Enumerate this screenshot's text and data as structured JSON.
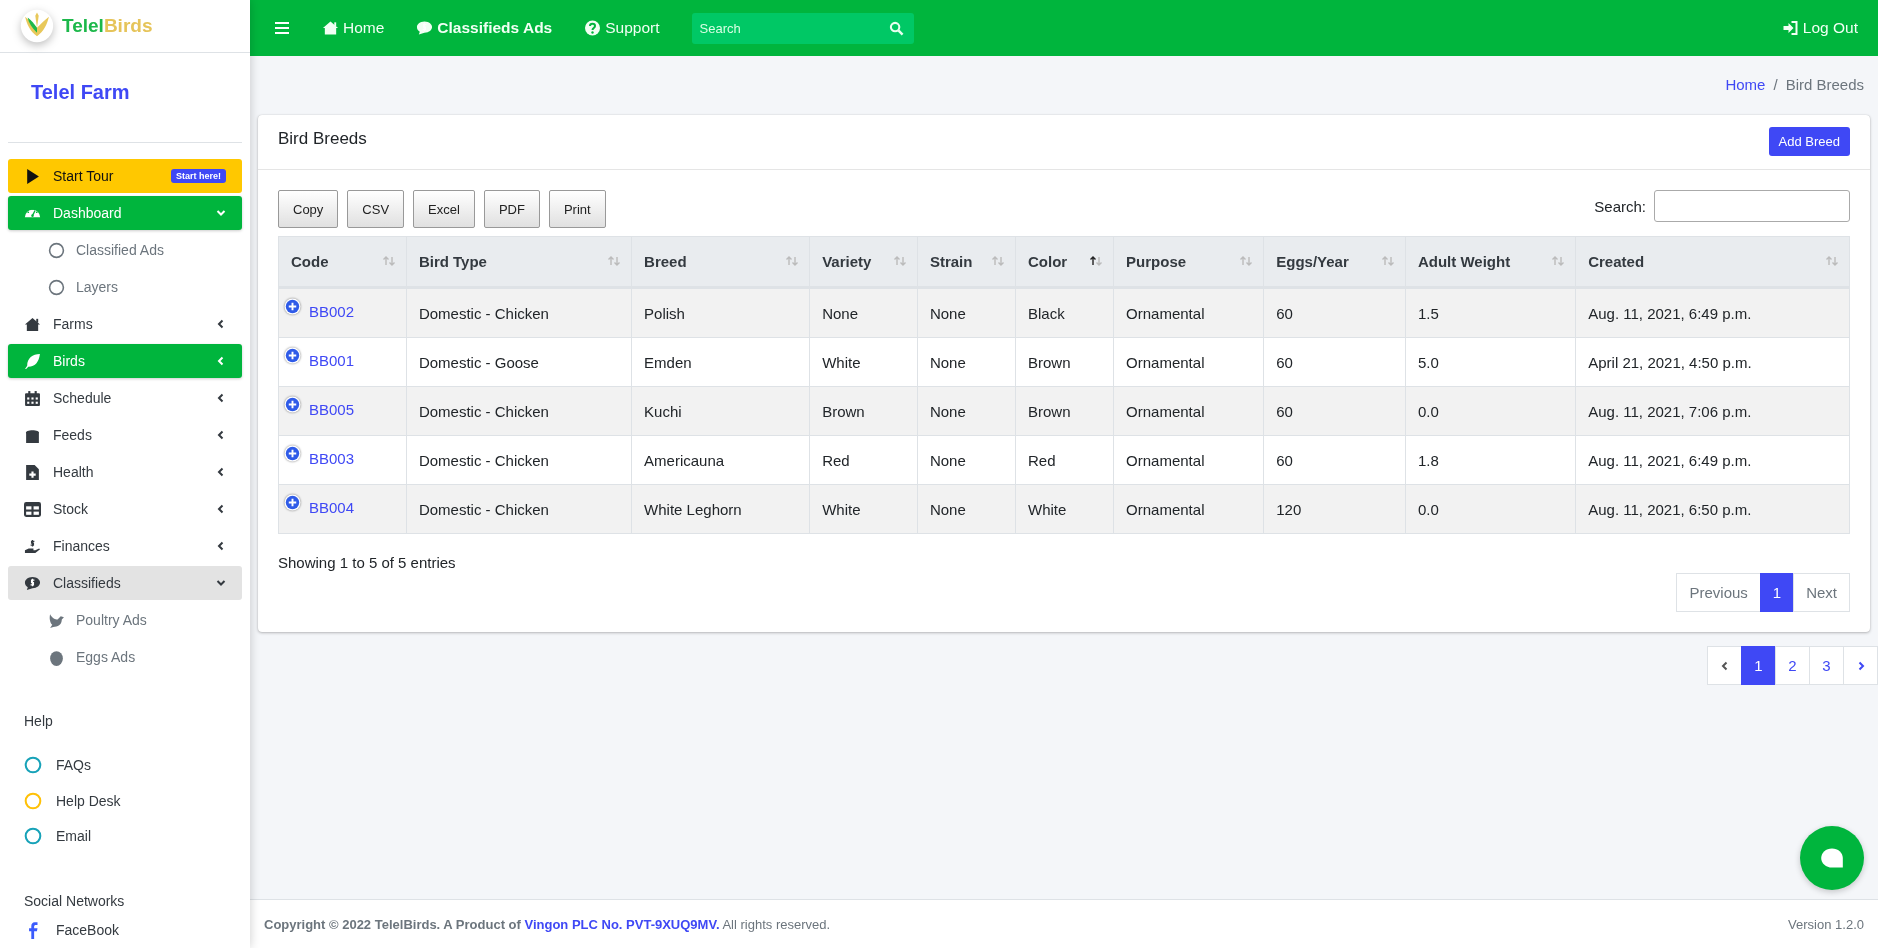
{
  "brand": {
    "part_1": "Telel",
    "part_2": "Birds"
  },
  "farm_name": "Telel Farm",
  "sidebar": {
    "items": [
      {
        "kind": "tour",
        "label": "Start Tour",
        "badge": "Start here!"
      },
      {
        "kind": "menu",
        "label": "Dashboard",
        "selected": true,
        "expanded": true,
        "children": [
          {
            "label": "Classified Ads"
          },
          {
            "label": "Layers"
          }
        ]
      },
      {
        "kind": "menu",
        "label": "Farms",
        "selected": false,
        "expanded": false
      },
      {
        "kind": "menu",
        "label": "Birds",
        "selected": true,
        "expanded": false
      },
      {
        "kind": "menu",
        "label": "Schedule",
        "selected": false,
        "expanded": false
      },
      {
        "kind": "menu",
        "label": "Feeds",
        "selected": false,
        "expanded": false
      },
      {
        "kind": "menu",
        "label": "Health",
        "selected": false,
        "expanded": false
      },
      {
        "kind": "menu",
        "label": "Stock",
        "selected": false,
        "expanded": false
      },
      {
        "kind": "menu",
        "label": "Finances",
        "selected": false,
        "expanded": false
      },
      {
        "kind": "menu",
        "label": "Classifieds",
        "selected": false,
        "expanded": true,
        "children": [
          {
            "label": "Poultry Ads"
          },
          {
            "label": "Eggs Ads"
          }
        ]
      }
    ],
    "help": {
      "title": "Help",
      "links": [
        {
          "label": "FAQs",
          "color": "#17a2b8"
        },
        {
          "label": "Help Desk",
          "color": "#ffc107"
        },
        {
          "label": "Email",
          "color": "#17a2b8"
        }
      ]
    },
    "social": {
      "title": "Social Networks",
      "links": [
        {
          "label": "FaceBook"
        }
      ]
    }
  },
  "topbar": {
    "links": [
      {
        "label": "Home",
        "bold": false
      },
      {
        "label": "Classifieds Ads",
        "bold": true
      },
      {
        "label": "Support",
        "bold": false
      }
    ],
    "search": {
      "placeholder": "Search"
    },
    "logout": "Log Out"
  },
  "breadcrumb": {
    "separator": "/",
    "items": [
      {
        "label": "Home",
        "link": true
      },
      {
        "label": "Bird Breeds",
        "link": false
      }
    ]
  },
  "card": {
    "title": "Bird Breeds",
    "add_button": "Add Breed",
    "export_buttons": [
      "Copy",
      "CSV",
      "Excel",
      "PDF",
      "Print"
    ],
    "search_label": "Search:",
    "table": {
      "columns": [
        {
          "label": "Code",
          "sorted": false
        },
        {
          "label": "Bird Type",
          "sorted": false
        },
        {
          "label": "Breed",
          "sorted": false
        },
        {
          "label": "Variety",
          "sorted": false
        },
        {
          "label": "Strain",
          "sorted": false
        },
        {
          "label": "Color",
          "sorted": true
        },
        {
          "label": "Purpose",
          "sorted": false
        },
        {
          "label": "Eggs/Year",
          "sorted": false
        },
        {
          "label": "Adult Weight",
          "sorted": false
        },
        {
          "label": "Created",
          "sorted": false
        }
      ],
      "rows": [
        [
          "BB002",
          "Domestic - Chicken",
          "Polish",
          "None",
          "None",
          "Black",
          "Ornamental",
          "60",
          "1.5",
          "Aug. 11, 2021, 6:49 p.m."
        ],
        [
          "BB001",
          "Domestic - Goose",
          "Emden",
          "White",
          "None",
          "Brown",
          "Ornamental",
          "60",
          "5.0",
          "April 21, 2021, 4:50 p.m."
        ],
        [
          "BB005",
          "Domestic - Chicken",
          "Kuchi",
          "Brown",
          "None",
          "Brown",
          "Ornamental",
          "60",
          "0.0",
          "Aug. 11, 2021, 7:06 p.m."
        ],
        [
          "BB003",
          "Domestic - Chicken",
          "Americauna",
          "Red",
          "None",
          "Red",
          "Ornamental",
          "60",
          "1.8",
          "Aug. 11, 2021, 6:49 p.m."
        ],
        [
          "BB004",
          "Domestic - Chicken",
          "White Leghorn",
          "White",
          "None",
          "White",
          "Ornamental",
          "120",
          "0.0",
          "Aug. 11, 2021, 6:50 p.m."
        ]
      ]
    },
    "info": "Showing 1 to 5 of 5 entries",
    "pager": {
      "previous": "Previous",
      "next": "Next",
      "pages": [
        {
          "label": "1",
          "selected": true
        }
      ]
    }
  },
  "page_pager": {
    "pages": [
      {
        "label": "1",
        "selected": true
      },
      {
        "label": "2",
        "selected": false
      },
      {
        "label": "3",
        "selected": false
      }
    ]
  },
  "footer": {
    "text_1": "Copyright © 2022 TelelBirds. A Product of",
    "link": "Vingon PLC No. PVT-9XUQ9MV.",
    "text_2": "All rights reserved.",
    "version": "Version 1.2.0"
  }
}
